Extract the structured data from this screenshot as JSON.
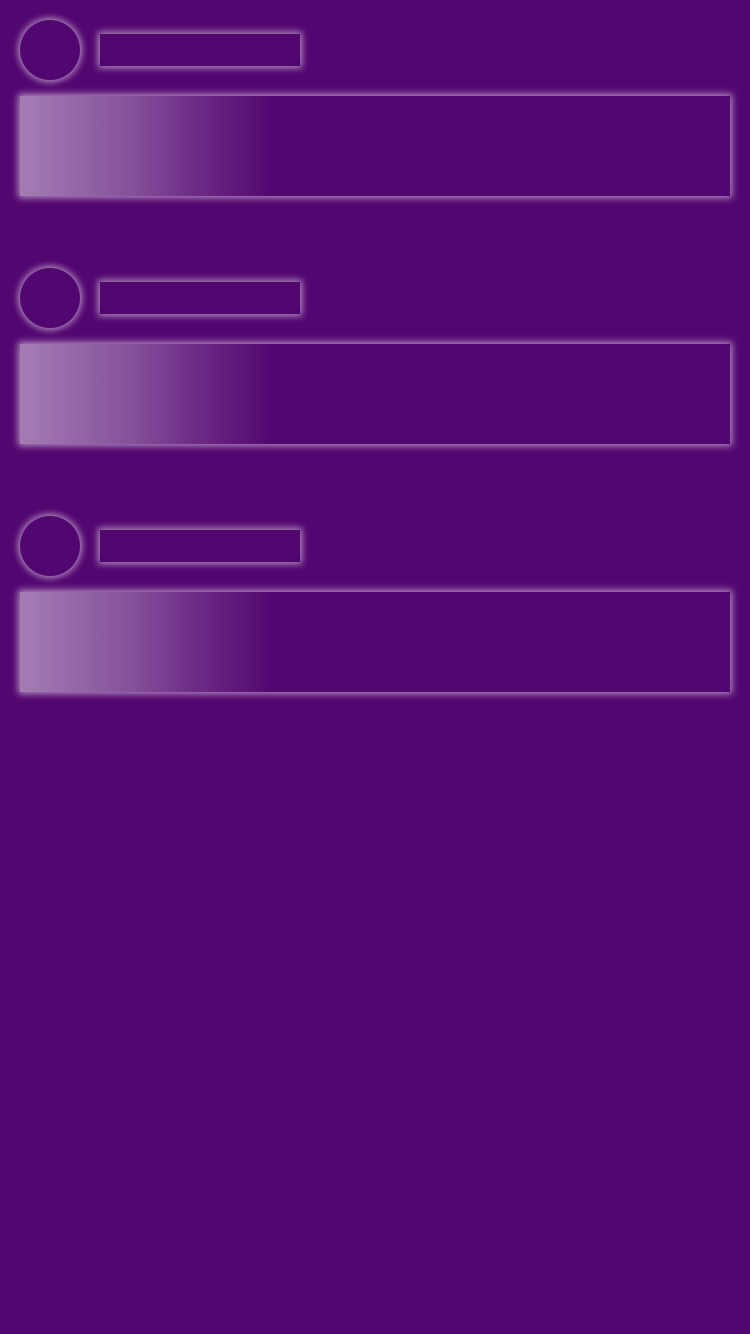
{
  "theme": {
    "background": "#520670",
    "glow": "#ffffff"
  },
  "loading_placeholders": [
    {
      "avatar": "placeholder",
      "title": "placeholder",
      "content": "placeholder"
    },
    {
      "avatar": "placeholder",
      "title": "placeholder",
      "content": "placeholder"
    },
    {
      "avatar": "placeholder",
      "title": "placeholder",
      "content": "placeholder"
    }
  ]
}
